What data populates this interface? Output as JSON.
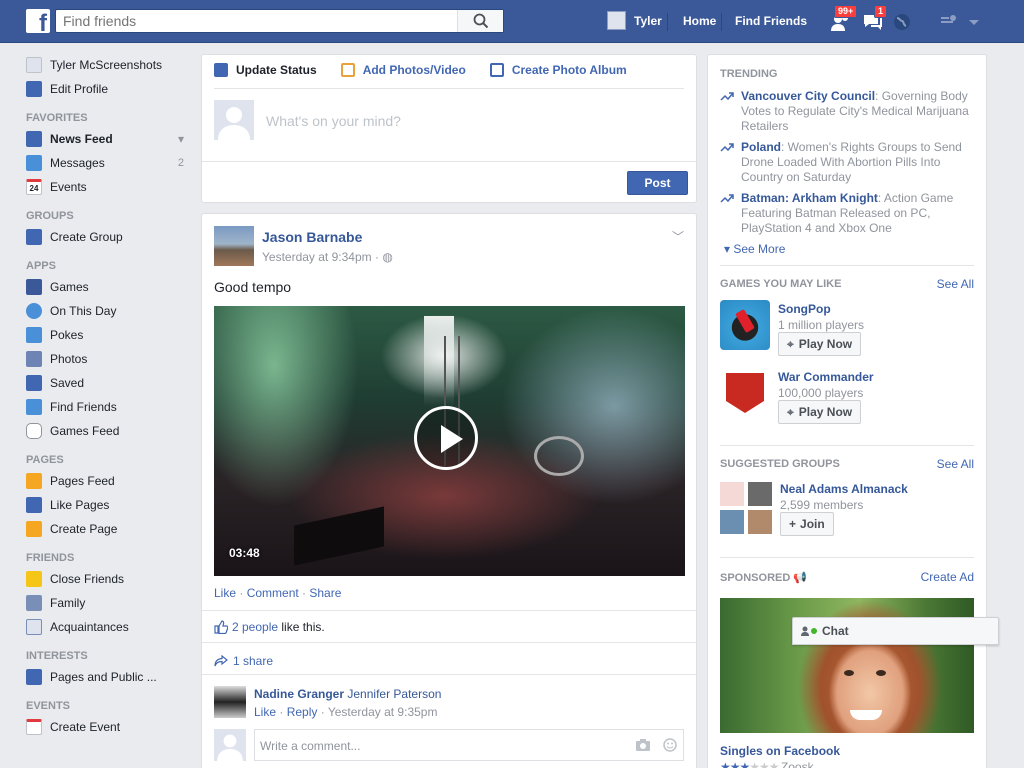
{
  "topbar": {
    "logo": "f",
    "search_placeholder": "Find friends",
    "user_name": "Tyler",
    "home_label": "Home",
    "find_friends_label": "Find Friends",
    "friend_requests_badge": "99+",
    "messages_badge": "1"
  },
  "leftnav": {
    "profile_name": "Tyler McScreenshots",
    "edit_profile": "Edit Profile",
    "favorites_head": "FAVORITES",
    "news_feed": "News Feed",
    "messages": "Messages",
    "messages_count": "2",
    "events": "Events",
    "events_icon_text": "24",
    "groups_head": "GROUPS",
    "create_group": "Create Group",
    "apps_head": "APPS",
    "games": "Games",
    "on_this_day": "On This Day",
    "pokes": "Pokes",
    "photos": "Photos",
    "saved": "Saved",
    "find_friends": "Find Friends",
    "games_feed": "Games Feed",
    "pages_head": "PAGES",
    "pages_feed": "Pages Feed",
    "like_pages": "Like Pages",
    "create_page": "Create Page",
    "friends_head": "FRIENDS",
    "close_friends": "Close Friends",
    "family": "Family",
    "acquaintances": "Acquaintances",
    "interests_head": "INTERESTS",
    "pages_and_public": "Pages and Public ...",
    "events_head": "EVENTS",
    "create_event": "Create Event"
  },
  "composer": {
    "tab_update_status": "Update Status",
    "tab_add_photos": "Add Photos/Video",
    "tab_create_album": "Create Photo Album",
    "placeholder": "What's on your mind?",
    "post_label": "Post"
  },
  "post": {
    "author": "Jason Barnabe",
    "time": "Yesterday at 9:34pm ·",
    "text": "Good tempo",
    "video_duration": "03:48",
    "action_like": "Like",
    "action_comment": "Comment",
    "action_share": "Share",
    "likes_link": "2 people",
    "likes_suffix": " like this.",
    "shares": "1 share",
    "comment_author": "Nadine Granger",
    "comment_tag": "Jennifer Paterson",
    "comment_like": "Like",
    "comment_reply": "Reply",
    "comment_time": "Yesterday at 9:35pm",
    "write_placeholder": "Write a comment..."
  },
  "right": {
    "trending_head": "TRENDING",
    "trends": [
      {
        "topic": "Vancouver City Council",
        "desc": ": Governing Body Votes to Regulate City's Medical Marijuana Retailers"
      },
      {
        "topic": "Poland",
        "desc": ": Women's Rights Groups to Send Drone Loaded With Abortion Pills Into Country on Saturday"
      },
      {
        "topic": "Batman: Arkham Knight",
        "desc": ": Action Game Featuring Batman Released on PC, PlayStation 4 and Xbox One"
      }
    ],
    "see_more": "See More",
    "games_head": "GAMES YOU MAY LIKE",
    "games_see_all": "See All",
    "games": [
      {
        "name": "SongPop",
        "players": "1 million players",
        "button": "Play Now"
      },
      {
        "name": "War Commander",
        "players": "100,000 players",
        "button": "Play Now"
      }
    ],
    "groups_head": "SUGGESTED GROUPS",
    "groups_see_all": "See All",
    "group_name": "Neal Adams Almanack",
    "group_members": "2,599 members",
    "join_label": "Join",
    "sponsored_head": "SPONSORED",
    "create_ad": "Create Ad",
    "ad_title": "Singles on Facebook",
    "ad_sub": "Zoosk"
  },
  "chat": {
    "label": "Chat"
  },
  "colors": {
    "brand": "#3b5998",
    "link": "#365899",
    "badge": "#fa3e3e"
  }
}
